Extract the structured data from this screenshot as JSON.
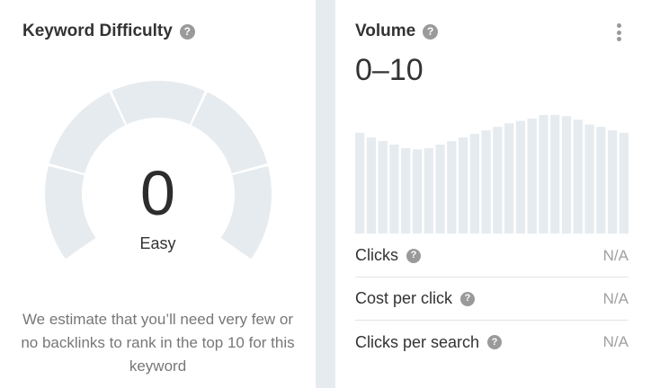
{
  "keyword_difficulty": {
    "title": "Keyword Difficulty",
    "help_icon": "?",
    "score": "0",
    "label": "Easy",
    "description": "We estimate that you’ll need very few or no backlinks to rank in the top 10 for this keyword",
    "gauge_track_color": "#e6ebef",
    "gauge_fill_fraction": 0
  },
  "volume": {
    "title": "Volume",
    "help_icon": "?",
    "value": "0–10",
    "bar_color": "#e6ebef",
    "trend_bars": [
      0.85,
      0.81,
      0.78,
      0.75,
      0.72,
      0.71,
      0.72,
      0.75,
      0.78,
      0.81,
      0.84,
      0.87,
      0.9,
      0.93,
      0.95,
      0.97,
      1.0,
      1.0,
      0.99,
      0.96,
      0.92,
      0.9,
      0.87,
      0.85
    ],
    "metrics": [
      {
        "name": "Clicks",
        "value": "N/A"
      },
      {
        "name": "Cost per click",
        "value": "N/A"
      },
      {
        "name": "Clicks per search",
        "value": "N/A"
      }
    ]
  }
}
